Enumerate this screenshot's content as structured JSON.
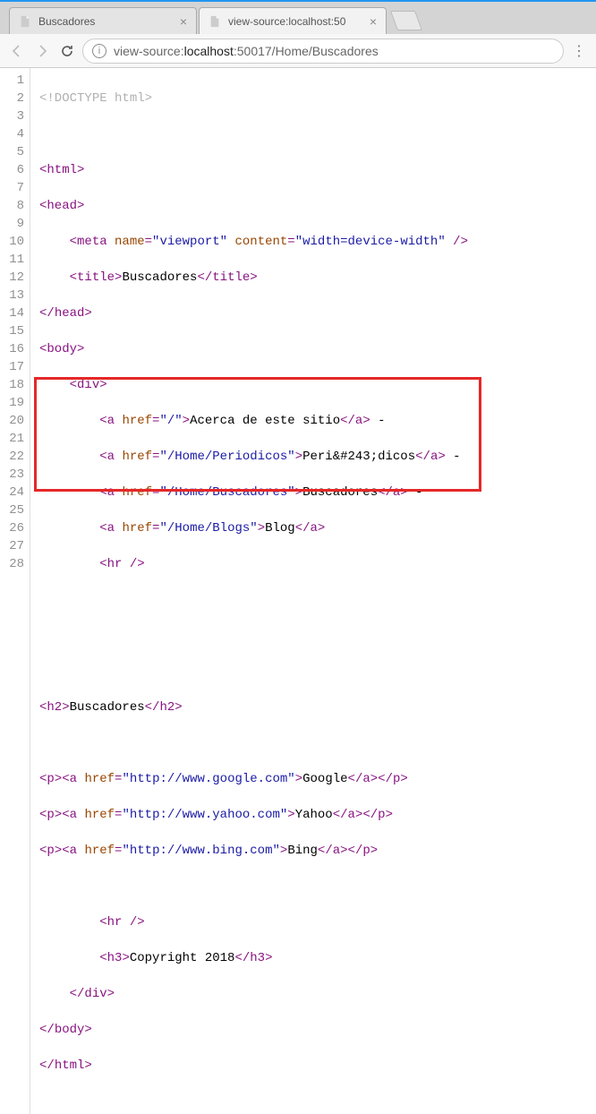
{
  "tabs": {
    "items": [
      {
        "title": "Buscadores",
        "active": false
      },
      {
        "title": "view-source:localhost:50",
        "active": true
      }
    ]
  },
  "omnibox": {
    "prefix": "view-source:",
    "host": "localhost",
    "rest": ":50017/Home/Buscadores"
  },
  "lines": [
    "1",
    "2",
    "3",
    "4",
    "5",
    "6",
    "7",
    "8",
    "9",
    "10",
    "11",
    "12",
    "13",
    "14",
    "15",
    "16",
    "17",
    "18",
    "19",
    "20",
    "21",
    "22",
    "23",
    "24",
    "25",
    "26",
    "27",
    "28"
  ],
  "src": {
    "title": "Buscadores",
    "meta_name": "viewport",
    "meta_content": "width=device-width",
    "nav": [
      {
        "href": "/",
        "text": "Acerca de este sitio"
      },
      {
        "href": "/Home/Periodicos",
        "text": "Peri&#243;dicos"
      },
      {
        "href": "/Home/Buscadores",
        "text": "Buscadores"
      },
      {
        "href": "/Home/Blogs",
        "text": "Blog"
      }
    ],
    "h2": "Buscadores",
    "links": [
      {
        "href": "http://www.google.com",
        "text": "Google"
      },
      {
        "href": "http://www.yahoo.com",
        "text": "Yahoo"
      },
      {
        "href": "http://www.bing.com",
        "text": "Bing"
      }
    ],
    "footer": "Copyright 2018"
  },
  "t": {
    "lt": "<",
    "gt": ">",
    "sl": "/",
    "eq": "=",
    "sp": " ",
    "dash": " - ",
    "q": "\"",
    "doctype": "!DOCTYPE html",
    "html": "html",
    "head": "head",
    "body": "body",
    "div": "div",
    "a": "a",
    "title_tag": "title",
    "meta": "meta",
    "name": "name",
    "content": "content",
    "href": "href",
    "hr": "hr /",
    "h2": "h2",
    "h3": "h3",
    "p": "p"
  }
}
